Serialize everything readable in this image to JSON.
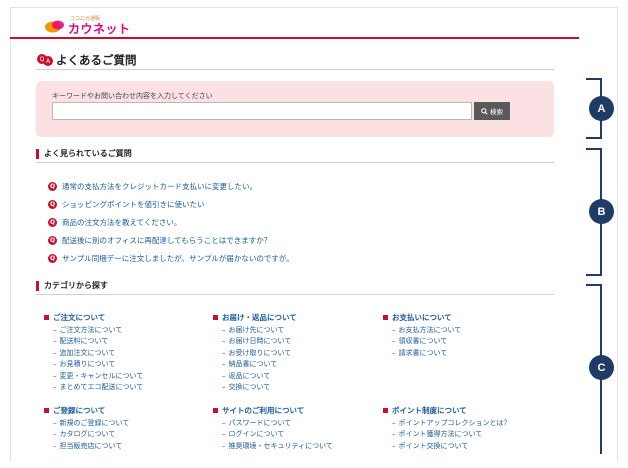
{
  "header": {
    "logo_sub": "ココロガ通販",
    "logo_main": "カウネット"
  },
  "page": {
    "title": "よくあるご質問"
  },
  "search": {
    "label": "キーワードやお問い合わせ内容を入力してください",
    "value": "",
    "button_label": "検索"
  },
  "faq_section": {
    "title": "よく見られているご質問",
    "items": [
      "通常の支払方法をクレジットカード支払いに変更したい。",
      "ショッピングポイントを値引きに使いたい",
      "商品の注文方法を教えてください。",
      "配送後に別のオフィスに再配達してもらうことはできますか？",
      "サンプル同梱デーに注文しましたが、サンプルが届かないのですが。"
    ]
  },
  "category_section": {
    "title": "カテゴリから探す",
    "columns": [
      {
        "title": "ご注文について",
        "items": [
          "ご注文方法について",
          "配送料について",
          "追加注文について",
          "お見積りについて",
          "変更・キャンセルについて",
          "まとめてエコ配送について"
        ]
      },
      {
        "title": "お届け・返品について",
        "items": [
          "お届け先について",
          "お届け日時について",
          "お受け取りについて",
          "納品書について",
          "返品について",
          "交換について"
        ]
      },
      {
        "title": "お支払いについて",
        "items": [
          "お支払方法について",
          "領収書について",
          "請求書について"
        ]
      },
      {
        "title": "ご登録について",
        "items": [
          "新規のご登録について",
          "カタログについて",
          "担当販売店について"
        ]
      },
      {
        "title": "サイトのご利用について",
        "items": [
          "パスワードについて",
          "ログインについて",
          "推奨環境・セキュリティについて"
        ]
      },
      {
        "title": "ポイント制度について",
        "items": [
          "ポイントアップコレクションとは？",
          "ポイント獲得方法について",
          "ポイント交換について"
        ]
      }
    ]
  },
  "annotations": {
    "a": "A",
    "b": "B",
    "c": "C"
  },
  "colors": {
    "accent": "#c8102e",
    "link": "#1a5a9e",
    "search_bg": "#fbe0e4",
    "badge": "#1f3b66"
  }
}
